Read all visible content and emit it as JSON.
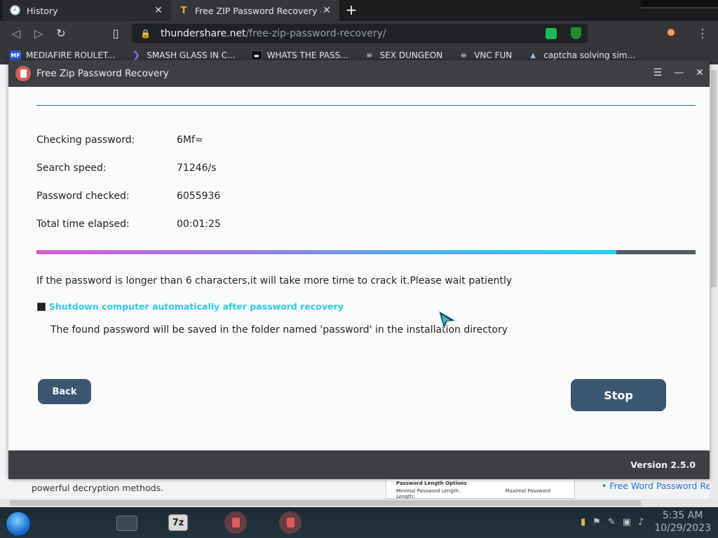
{
  "browser": {
    "tabs": [
      {
        "label": "History",
        "icon": "history-icon"
      },
      {
        "label": "Free ZIP Password Recovery - A sc",
        "icon": "thundershare-favicon"
      }
    ],
    "url": {
      "host": "thundershare.net",
      "path": "/free-zip-password-recovery/"
    },
    "bookmarks": [
      {
        "label": "MEDIAFIRE ROULET...",
        "icon": "mediafire-icon"
      },
      {
        "label": "SMASH GLASS IN C...",
        "icon": "visual-studio-icon"
      },
      {
        "label": "WHATS THE PASS...",
        "icon": "terminal-icon"
      },
      {
        "label": "SEX DUNGEON",
        "icon": "skull-icon"
      },
      {
        "label": "VNC FUN",
        "icon": "skull-icon"
      },
      {
        "label": "captcha solving sim...",
        "icon": "arch-icon"
      }
    ]
  },
  "webpage": {
    "text": "powerful decryption methods.",
    "screenshot_title": "Password Length Options",
    "screenshot_min": "Minimal Password Length:",
    "screenshot_max": "Maximal Password Length:",
    "link": "Free Word Password Re"
  },
  "app": {
    "title": "Free Zip Password Recovery",
    "rows": [
      {
        "label": "Checking password:",
        "value": "6Mf="
      },
      {
        "label": "Search speed:",
        "value": "71246/s"
      },
      {
        "label": "Password checked:",
        "value": "6055936"
      },
      {
        "label": "Total time elapsed:",
        "value": "00:01:25"
      }
    ],
    "progress_fraction": 0.88,
    "notice": "If the password is longer than 6 characters,it will take more time to crack it.Please wait patiently",
    "checkbox_label": "Shutdown computer automatically after password recovery",
    "saved_note": "The found password will be saved in the folder named 'password' in the installation directory",
    "back_label": "Back",
    "stop_label": "Stop",
    "version": "Version 2.5.0"
  },
  "taskbar": {
    "sevenzip_label": "7z",
    "time": "5:35 AM",
    "date": "10/29/2023"
  },
  "colors": {
    "accent": "#31c9e6",
    "button": "#3b5670",
    "titlebar": "#3d3f42"
  }
}
